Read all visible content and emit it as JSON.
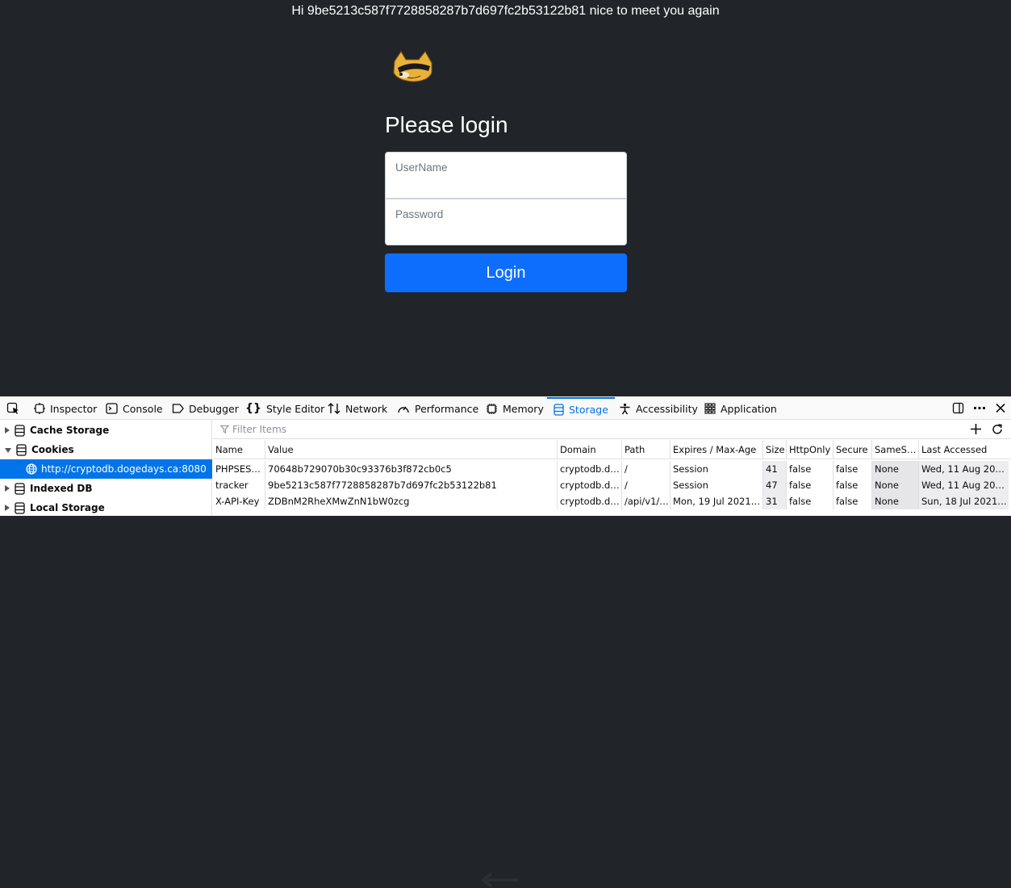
{
  "page": {
    "greeting": "Hi 9be5213c587f7728858287b7d697fc2b53122b81 nice to meet you again",
    "title": "Please login",
    "username_placeholder": "UserName",
    "password_placeholder": "Password",
    "login_label": "Login"
  },
  "devtools": {
    "tools": [
      {
        "label": "Inspector",
        "icon": "inspector-icon"
      },
      {
        "label": "Console",
        "icon": "console-icon"
      },
      {
        "label": "Debugger",
        "icon": "debugger-icon"
      },
      {
        "label": "Style Editor",
        "icon": "braces-icon"
      },
      {
        "label": "Network",
        "icon": "network-icon"
      },
      {
        "label": "Performance",
        "icon": "performance-icon"
      },
      {
        "label": "Memory",
        "icon": "memory-icon"
      },
      {
        "label": "Storage",
        "icon": "storage-icon",
        "active": true
      },
      {
        "label": "Accessibility",
        "icon": "accessibility-icon"
      },
      {
        "label": "Application",
        "icon": "application-icon"
      }
    ],
    "sidebar": {
      "cache_storage": "Cache Storage",
      "cookies": "Cookies",
      "host": "http://cryptodb.dogedays.ca:8080",
      "indexed_db": "Indexed DB",
      "local_storage": "Local Storage"
    },
    "filter_placeholder": "Filter Items",
    "columns": [
      "Name",
      "Value",
      "Domain",
      "Path",
      "Expires / Max-Age",
      "Size",
      "HttpOnly",
      "Secure",
      "SameSite",
      "Last Accessed"
    ],
    "rows": [
      [
        "PHPSES…",
        "70648b729070b30c93376b3f872cb0c5",
        "cryptodb.d…",
        "/",
        "Session",
        "41",
        "false",
        "false",
        "None",
        "Wed, 11 Aug 2021 …"
      ],
      [
        "tracker",
        "9be5213c587f7728858287b7d697fc2b53122b81",
        "cryptodb.d…",
        "/",
        "Session",
        "47",
        "false",
        "false",
        "None",
        "Wed, 11 Aug 2021 …"
      ],
      [
        "X-API-Key",
        "ZDBnM2RheXMwZnN1bW0zcg",
        "cryptodb.d…",
        "/api/v1/…",
        "Mon, 19 Jul 2021 1…",
        "31",
        "false",
        "false",
        "None",
        "Sun, 18 Jul 2021 1…"
      ]
    ]
  },
  "colors": {
    "page_bg": "#212529",
    "login_button": "#0d6efd",
    "devtools_accent": "#0074e8"
  }
}
